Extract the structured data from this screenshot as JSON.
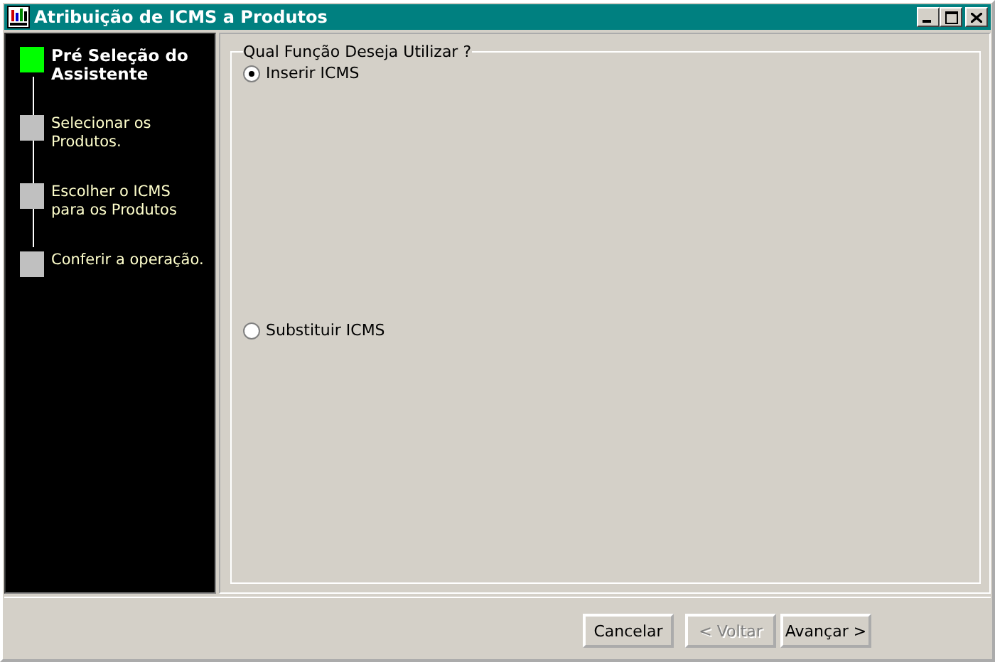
{
  "window": {
    "title": "Atribuição de ICMS a Produtos"
  },
  "steps": [
    {
      "label": "Pré Seleção do Assistente",
      "selected": true
    },
    {
      "label": "Selecionar os Produtos.",
      "selected": false
    },
    {
      "label": "Escolher o ICMS para os Produtos",
      "selected": false
    },
    {
      "label": "Conferir a operação.",
      "selected": false
    }
  ],
  "group": {
    "title": "Qual Função Deseja Utilizar ?",
    "options": [
      {
        "label": "Inserir ICMS",
        "selected": true
      },
      {
        "label": "Substituir ICMS",
        "selected": false
      }
    ]
  },
  "buttons": [
    {
      "label": "Cancelar",
      "disabled": false
    },
    {
      "label": "< Voltar",
      "disabled": true
    },
    {
      "label": "Avançar >",
      "disabled": false
    }
  ]
}
